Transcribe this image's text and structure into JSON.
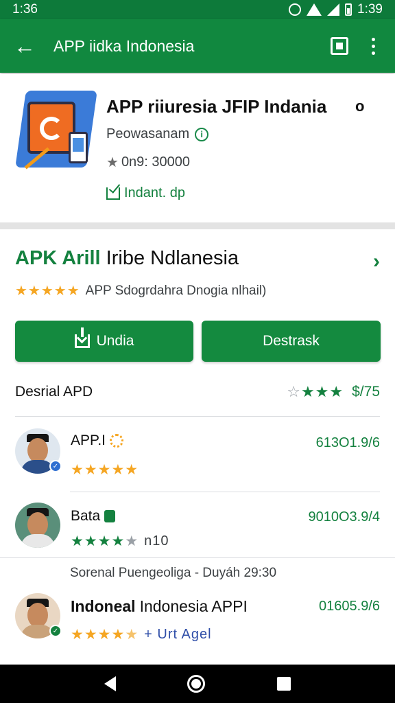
{
  "status_bar": {
    "time": "1:36",
    "time_right": "1:39"
  },
  "app_bar": {
    "title": "APP iidka Indonesia"
  },
  "app_header": {
    "name": "APP riiuresia JFIP Indania",
    "name_suffix": "o",
    "developer": "Peowasanam",
    "rating_text": "0n9: 30000",
    "installed_text": "Indant. dp"
  },
  "details": {
    "title_green": "APK Arill",
    "title_rest": " Iribe Ndlanesia",
    "stars": "★★★★★",
    "subtitle": "APP Sdogrdahra Dnogia nlhail)",
    "install_button": "Undia",
    "secondary_button": "Destrask"
  },
  "summary": {
    "label": "Desrial APD",
    "filled_stars": "★★★",
    "empty_star": "☆",
    "score": "$/75"
  },
  "reviews": [
    {
      "name": "APP.I",
      "stars": "★★★★★",
      "value": "613O1.9/6",
      "extra": ""
    },
    {
      "name": "Bata",
      "stars": "★★★★",
      "empty": "★",
      "value": "9010O3.9/4",
      "extra": "n10"
    },
    {
      "name": "Indoneal",
      "name_rest": " Indonesia APPI",
      "stars": "★★★★",
      "half": "★",
      "value": "01605.9/6",
      "extra": "+ Urt Agel"
    }
  ],
  "section_note": "Sorenal Puengeoliga - Duyáh 29:30",
  "colors": {
    "primary": "#148a3f",
    "status_bar": "#0d7a3a",
    "star_gold": "#f5a623"
  },
  "icons": [
    "back-arrow-icon",
    "square-icon",
    "more-vert-icon",
    "info-icon",
    "star-icon",
    "install-check-icon",
    "chevron-right-icon",
    "download-icon",
    "verified-badge-icon"
  ]
}
